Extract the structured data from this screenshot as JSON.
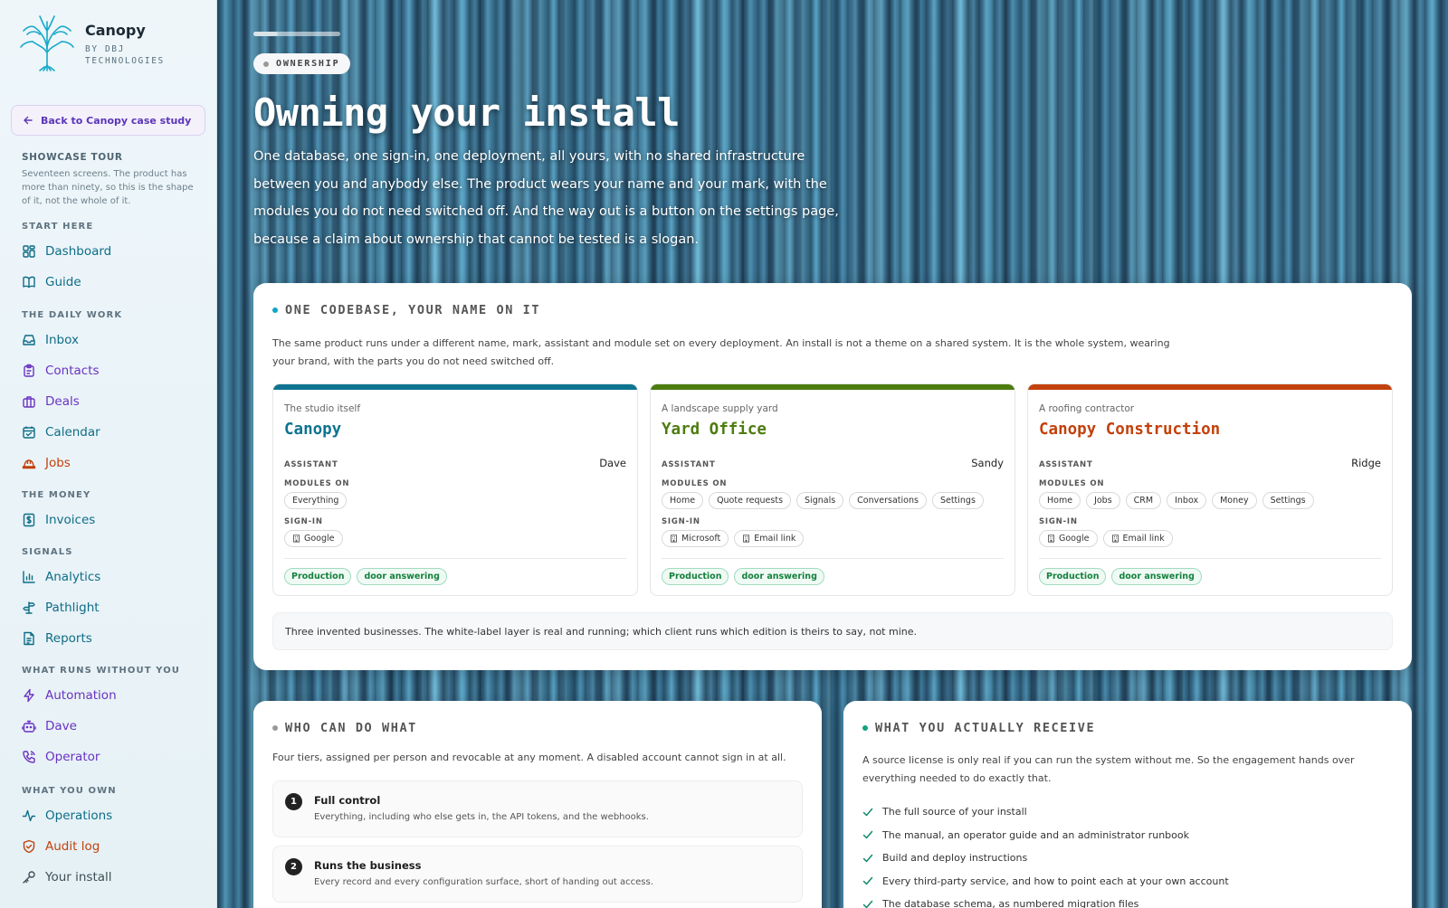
{
  "brand": {
    "name": "Canopy",
    "sub": "BY DBJ TECHNOLOGIES"
  },
  "sidebar": {
    "back_label": "Back to Canopy case study",
    "tour_title": "SHOWCASE TOUR",
    "tour_desc": "Seventeen screens. The product has more than ninety, so this is the shape of it, not the whole of it.",
    "sections": [
      {
        "title": "START HERE",
        "items": [
          {
            "label": "Dashboard",
            "icon": "grid-icon"
          },
          {
            "label": "Guide",
            "icon": "book-icon"
          }
        ]
      },
      {
        "title": "THE DAILY WORK",
        "items": [
          {
            "label": "Inbox",
            "icon": "inbox-icon"
          },
          {
            "label": "Contacts",
            "icon": "clipboard-icon"
          },
          {
            "label": "Deals",
            "icon": "briefcase-icon"
          },
          {
            "label": "Calendar",
            "icon": "calendar-icon"
          },
          {
            "label": "Jobs",
            "icon": "hardhat-icon"
          }
        ]
      },
      {
        "title": "THE MONEY",
        "items": [
          {
            "label": "Invoices",
            "icon": "dollar-icon"
          }
        ]
      },
      {
        "title": "SIGNALS",
        "items": [
          {
            "label": "Analytics",
            "icon": "bar-chart-icon"
          },
          {
            "label": "Pathlight",
            "icon": "signpost-icon"
          },
          {
            "label": "Reports",
            "icon": "document-icon"
          }
        ]
      },
      {
        "title": "WHAT RUNS WITHOUT YOU",
        "items": [
          {
            "label": "Automation",
            "icon": "lightning-icon"
          },
          {
            "label": "Dave",
            "icon": "robot-icon"
          },
          {
            "label": "Operator",
            "icon": "phone-icon"
          }
        ]
      },
      {
        "title": "WHAT YOU OWN",
        "items": [
          {
            "label": "Operations",
            "icon": "pulse-icon"
          },
          {
            "label": "Audit log",
            "icon": "shield-icon"
          },
          {
            "label": "Your install",
            "icon": "key-icon"
          }
        ]
      }
    ]
  },
  "hero": {
    "progress": 0.28,
    "pill": "OWNERSHIP",
    "title": "Owning your install",
    "desc": "One database, one sign-in, one deployment, all yours, with no shared infrastructure between you and anybody else. The product wears your name and your mark, with the modules you do not need switched off. And the way out is a button on the settings page, because a claim about ownership that cannot be tested is a slogan."
  },
  "codebase": {
    "heading": "ONE CODEBASE, YOUR NAME ON IT",
    "desc": "The same product runs under a different name, mark, assistant and module set on every deployment. An install is not a theme on a shared system. It is the whole system, wearing your brand, with the parts you do not need switched off.",
    "labels": {
      "assistant": "ASSISTANT",
      "modules": "MODULES ON",
      "signin": "SIGN-IN"
    },
    "tenants": [
      {
        "kind": "The studio itself",
        "name": "Canopy",
        "color": "#0e7490",
        "assistant": "Dave",
        "modules": [
          "Everything"
        ],
        "signin": [
          "Google"
        ],
        "tags": [
          "Production",
          "door answering"
        ]
      },
      {
        "kind": "A landscape supply yard",
        "name": "Yard Office",
        "color": "#4d7c0f",
        "assistant": "Sandy",
        "modules": [
          "Home",
          "Quote requests",
          "Signals",
          "Conversations",
          "Settings"
        ],
        "signin": [
          "Microsoft",
          "Email link"
        ],
        "tags": [
          "Production",
          "door answering"
        ]
      },
      {
        "kind": "A roofing contractor",
        "name": "Canopy Construction",
        "color": "#c2410c",
        "assistant": "Ridge",
        "modules": [
          "Home",
          "Jobs",
          "CRM",
          "Inbox",
          "Money",
          "Settings"
        ],
        "signin": [
          "Google",
          "Email link"
        ],
        "tags": [
          "Production",
          "door answering"
        ]
      }
    ],
    "note": "Three invented businesses. The white-label layer is real and running; which client runs which edition is theirs to say, not mine."
  },
  "who": {
    "heading": "WHO CAN DO WHAT",
    "desc": "Four tiers, assigned per person and revocable at any moment. A disabled account cannot sign in at all.",
    "tiers": [
      {
        "num": "1",
        "title": "Full control",
        "desc": "Everything, including who else gets in, the API tokens, and the webhooks."
      },
      {
        "num": "2",
        "title": "Runs the business",
        "desc": "Every record and every configuration surface, short of handing out access."
      }
    ]
  },
  "receive": {
    "heading": "WHAT YOU ACTUALLY RECEIVE",
    "desc": "A source license is only real if you can run the system without me. So the engagement hands over everything needed to do exactly that.",
    "items": [
      "The full source of your install",
      "The manual, an operator guide and an administrator runbook",
      "Build and deploy instructions",
      "Every third-party service, and how to point each at your own account",
      "The database schema, as numbered migration files"
    ]
  },
  "colors": {
    "teal": "#0e6d86",
    "purple": "#6a33c2",
    "orange": "#c2410c",
    "green_check": "#0f8a6a"
  }
}
